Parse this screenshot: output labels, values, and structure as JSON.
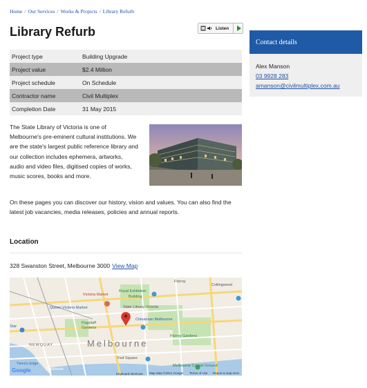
{
  "breadcrumb": [
    "Home",
    "Our Services",
    "Works & Projects",
    "Library Refurb"
  ],
  "page_title": "Library Refurb",
  "listen_label": "Listen",
  "details": [
    {
      "label": "Project type",
      "value": "Building Upgrade"
    },
    {
      "label": "Project value",
      "value": "$2.4 Million"
    },
    {
      "label": "Project schedule",
      "value": "On Schedule"
    },
    {
      "label": "Contractor name",
      "value": "Civil Multiplex"
    },
    {
      "label": "Completion Date",
      "value": "31 May 2015"
    }
  ],
  "intro_text": "The State Library of Victoria is one of Melbourne's pre-eminent cultural institutions. We are the state's largest public reference library and our collection includes ephemera, artworks, audio and video files, digitised copies of works, music scores, books and more.",
  "body_text": "On these pages you can discover our history, vision and values. You can also find the latest job vacancies, media releases, policies and annual reports.",
  "location": {
    "heading": "Location",
    "address": "328 Swanston Street, Melbourne 3000",
    "view_map_label": "View Map"
  },
  "map": {
    "labels": {
      "fitzroy": "Fitzroy",
      "collingwood": "Collingwood",
      "victoria_market": "Victoria Market",
      "royal_exhibition": "Royal Exhibition",
      "building": "Building",
      "queen_victoria_market": "Queen Victoria Market",
      "state_library": "State Library Victoria",
      "flagstaff": "Flagstaff",
      "gardens": "Gardens",
      "chinatown": "Chinatown Melbourne",
      "star": "Star",
      "newquay": "NEWQUAY",
      "melbourne": "Melbourne",
      "fitzroy_gardens": "Fitzroy Gardens",
      "fed_square": "Fed Square",
      "yarra": "Yarra's Edge",
      "docklands": "Docklands",
      "melbourne_cricket": "Melbourne Cricket Ground",
      "google": "Google",
      "keyboard": "Keyboard shortcuts",
      "map_data": "Map data ©2021 Google",
      "terms": "Terms of Use",
      "report": "Report a map error"
    }
  },
  "contact": {
    "heading": "Contact details",
    "name": "Alex Manson",
    "phone": "03 9928 283",
    "email": "amanson@civilmultiplex.com.au"
  },
  "colors": {
    "brand_blue": "#1f5aa6",
    "link": "#1f4fa3",
    "row_dark": "#b9b9b9",
    "row_light": "#efefef",
    "map_pin": "#d93a2e"
  }
}
